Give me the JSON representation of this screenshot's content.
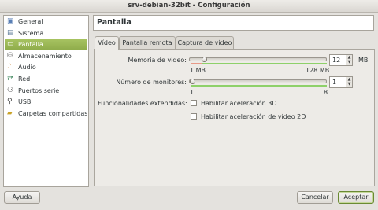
{
  "window": {
    "title": "srv-debian-32bit - Configuración"
  },
  "sidebar": {
    "items": [
      {
        "label": "General",
        "icon": "general-icon",
        "selected": false
      },
      {
        "label": "Sistema",
        "icon": "system-icon",
        "selected": false
      },
      {
        "label": "Pantalla",
        "icon": "display-icon",
        "selected": true
      },
      {
        "label": "Almacenamiento",
        "icon": "storage-icon",
        "selected": false
      },
      {
        "label": "Audio",
        "icon": "audio-icon",
        "selected": false
      },
      {
        "label": "Red",
        "icon": "network-icon",
        "selected": false
      },
      {
        "label": "Puertos serie",
        "icon": "serial-port-icon",
        "selected": false
      },
      {
        "label": "USB",
        "icon": "usb-icon",
        "selected": false
      },
      {
        "label": "Carpetas compartidas",
        "icon": "shared-folder-icon",
        "selected": false
      }
    ]
  },
  "page": {
    "title": "Pantalla"
  },
  "tabs": [
    {
      "label": "Vídeo",
      "active": true
    },
    {
      "label": "Pantalla remota",
      "active": false
    },
    {
      "label": "Captura de vídeo",
      "active": false
    }
  ],
  "video": {
    "memory_label": "Memoria de vídeo:",
    "memory_value": "12",
    "memory_unit": "MB",
    "memory_min": "1 MB",
    "memory_max": "128 MB",
    "memory_fraction": 0.09,
    "monitors_label": "Número de monitores:",
    "monitors_value": "1",
    "monitors_min": "1",
    "monitors_max": "8",
    "monitors_fraction": 0.0,
    "features_label": "Funcionalidades extendidas:",
    "accel3d_label": "Habilitar aceleración 3D",
    "accel3d_checked": false,
    "accel2d_label": "Habilitar aceleración de vídeo 2D",
    "accel2d_checked": false
  },
  "buttons": {
    "help": "Ayuda",
    "cancel": "Cancelar",
    "accept": "Aceptar"
  },
  "colors": {
    "selection": "#9bb756",
    "range_ok": "#8ed16a",
    "range_bad": "#e89a88"
  }
}
